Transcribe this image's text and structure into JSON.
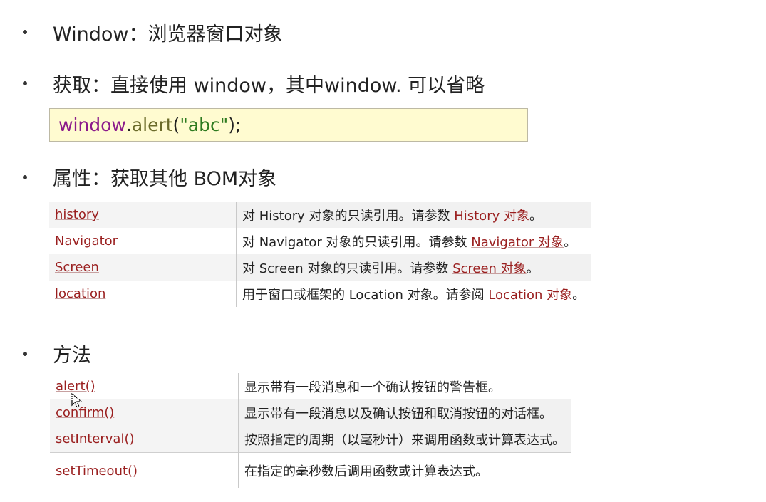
{
  "bullets": {
    "window": "Window：浏览器窗口对象",
    "get": "获取：直接使用 window，其中window. 可以省略",
    "props": "属性：获取其他 BOM对象",
    "methods": "方法"
  },
  "code": {
    "obj": "window",
    "dot": ".",
    "fn": "alert",
    "open": "(",
    "arg": "\"abc\"",
    "close": ");"
  },
  "properties": [
    {
      "name": "history",
      "desc": "对 History 对象的只读引用。请参数 ",
      "link": "History 对象",
      "end": "。"
    },
    {
      "name": "Navigator",
      "desc": "对 Navigator 对象的只读引用。请参数 ",
      "link": "Navigator 对象",
      "end": "。"
    },
    {
      "name": "Screen",
      "desc": "对 Screen 对象的只读引用。请参数 ",
      "link": "Screen 对象",
      "end": "。"
    },
    {
      "name": "location",
      "desc": "用于窗口或框架的 Location 对象。请参阅 ",
      "link": "Location 对象",
      "end": "。"
    }
  ],
  "methods": [
    {
      "name": "alert()",
      "desc": "显示带有一段消息和一个确认按钮的警告框。"
    },
    {
      "name": "confirm()",
      "desc": "显示带有一段消息以及确认按钮和取消按钮的对话框。"
    },
    {
      "name": "setInterval()",
      "desc": "按照指定的周期（以毫秒计）来调用函数或计算表达式。"
    },
    {
      "name": "setTimeout()",
      "desc": "在指定的毫秒数后调用函数或计算表达式。"
    }
  ]
}
